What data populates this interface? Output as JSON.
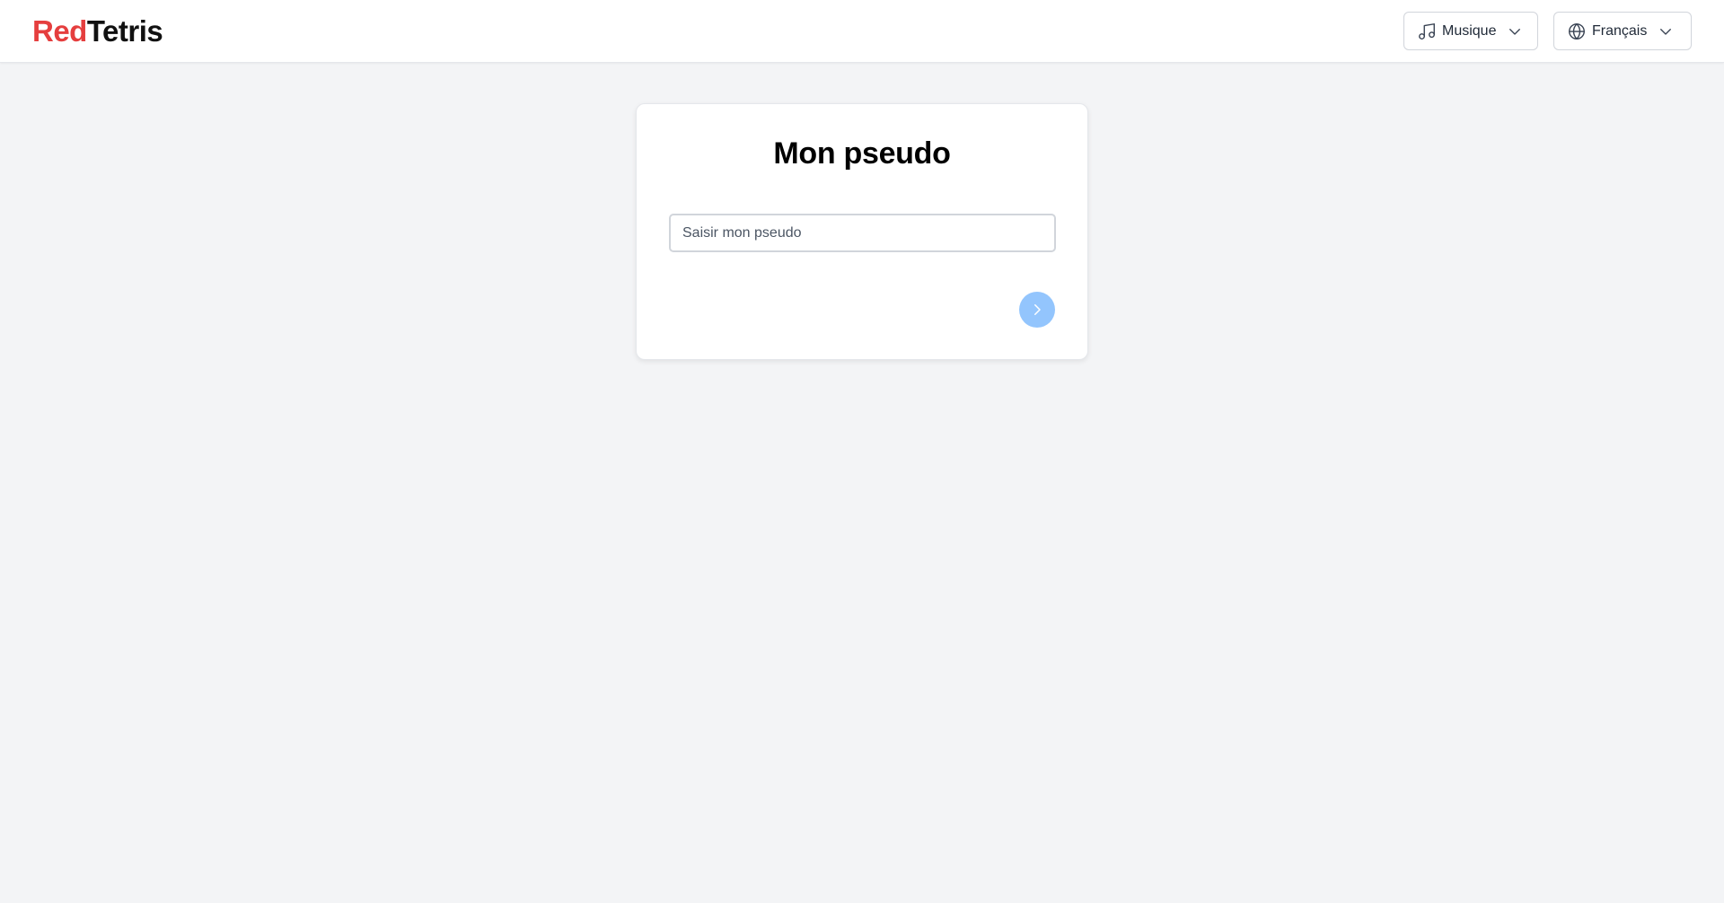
{
  "header": {
    "logo_part1": "Red",
    "logo_part2": "Tetris",
    "music_dropdown": {
      "label": "Musique",
      "icon": "music-note-icon"
    },
    "language_dropdown": {
      "label": "Français",
      "icon": "globe-icon"
    }
  },
  "card": {
    "title": "Mon pseudo",
    "input_placeholder": "Saisir mon pseudo",
    "input_value": "",
    "next_button_icon": "chevron-right-icon"
  },
  "colors": {
    "logo_red": "#e53e3e",
    "background": "#f3f4f6",
    "button_blue": "#93c5fd"
  }
}
